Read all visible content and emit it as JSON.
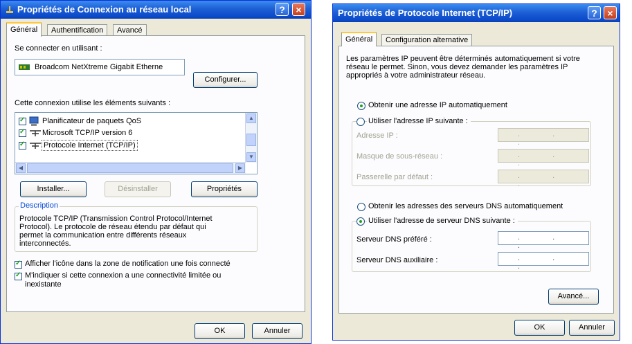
{
  "left": {
    "title": "Propriétés de Connexion au réseau local",
    "help_button": "?",
    "close_button": "×",
    "tabs": [
      {
        "label": "Général"
      },
      {
        "label": "Authentification"
      },
      {
        "label": "Avancé"
      }
    ],
    "connect_using_label": "Se connecter en utilisant :",
    "adapter_name": "Broadcom NetXtreme Gigabit Etherne",
    "configure_button": "Configurer...",
    "elements_label": "Cette connexion utilise les éléments suivants :",
    "components": [
      {
        "label": "Planificateur de paquets QoS",
        "checked": true
      },
      {
        "label": "Microsoft TCP/IP version 6",
        "checked": true
      },
      {
        "label": "Protocole Internet (TCP/IP)",
        "checked": true
      }
    ],
    "install_button": "Installer...",
    "uninstall_button": "Désinstaller",
    "properties_button": "Propriétés",
    "description_title": "Description",
    "description_lines": [
      "Protocole TCP/IP (Transmission Control Protocol/Internet",
      "Protocol). Le protocole de réseau étendu par défaut qui",
      "permet la communication entre différents réseaux",
      "interconnectés."
    ],
    "show_icon_label": "Afficher l'icône dans la zone de notification une fois connecté",
    "notify_lines": [
      "M'indiquer si cette connexion a une connectivité limitée ou",
      "inexistante"
    ],
    "ok_button": "OK",
    "cancel_button": "Annuler"
  },
  "right": {
    "title": "Propriétés de Protocole Internet (TCP/IP)",
    "help_button": "?",
    "close_button": "×",
    "tabs": [
      {
        "label": "Général"
      },
      {
        "label": "Configuration alternative"
      }
    ],
    "intro_lines": [
      "Les paramètres IP peuvent être déterminés automatiquement si votre",
      "réseau le permet. Sinon, vous devez demander les paramètres IP",
      "appropriés à votre administrateur réseau."
    ],
    "obtain_ip_auto": "Obtenir une adresse IP automatiquement",
    "use_ip": "Utiliser l'adresse IP suivante :",
    "ip_address_label": "Adresse IP :",
    "subnet_label": "Masque de sous-réseau :",
    "gateway_label": "Passerelle par défaut :",
    "ip_dots": ". . .",
    "obtain_dns_auto": "Obtenir les adresses des serveurs DNS automatiquement",
    "use_dns": "Utiliser l'adresse de serveur DNS suivante :",
    "preferred_dns_label": "Serveur DNS préféré :",
    "alternate_dns_label": "Serveur DNS auxiliaire :",
    "advanced_button": "Avancé...",
    "ok_button": "OK",
    "cancel_button": "Annuler",
    "ip_mode": "auto",
    "dns_mode": "manual"
  },
  "colors": {
    "title_bar": "#0a48c8",
    "dialog_bg": "#ece9d8",
    "panel_bg": "#fcfcfe",
    "accent_green": "#21a121"
  }
}
